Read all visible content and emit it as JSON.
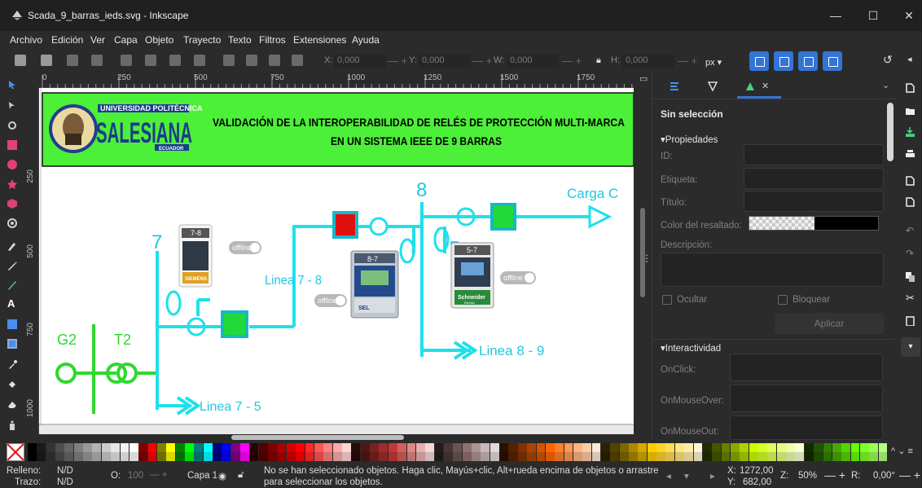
{
  "window": {
    "title": "Scada_9_barras_ieds.svg - Inkscape"
  },
  "menu": [
    "Archivo",
    "Edición",
    "Ver",
    "Capa",
    "Objeto",
    "Trayecto",
    "Texto",
    "Filtros",
    "Extensiones",
    "Ayuda"
  ],
  "toolbar": {
    "x_label": "X:",
    "x_value": "0,000",
    "y_label": "Y:",
    "y_value": "0,000",
    "w_label": "W:",
    "w_value": "0,000",
    "h_label": "H:",
    "h_value": "0,000",
    "unit": "px"
  },
  "ruler": {
    "h_ticks": [
      "0",
      "250",
      "500",
      "750",
      "1000",
      "1250",
      "1500",
      "1750"
    ],
    "v_ticks": [
      "250",
      "500",
      "750",
      "1000"
    ]
  },
  "drawing": {
    "university_top": "UNIVERSIDAD POLITÉCNICA",
    "university_name": "SALESIANA",
    "university_country": "ECUADOR",
    "title_line1": "VALIDACIÓN DE LA INTEROPERABILIDAD DE RELÉS DE PROTECCIÓN MULTI-MARCA",
    "title_line2": "EN UN SISTEMA IEEE DE 9 BARRAS",
    "bus7": "7",
    "bus8": "8",
    "gen": "G2",
    "trafo": "T2",
    "carga": "Carga C",
    "linea78": "Linea 7 - 8",
    "linea89": "Linea 8 - 9",
    "linea75": "Linea 7 - 5",
    "relay1_id": "7-8",
    "relay1_brand": "SIEMENS",
    "relay2_id": "8-7",
    "relay2_brand": "SEL",
    "relay3_id": "5-7",
    "relay3_brand": "Schneider",
    "relay3_sub": "Electric",
    "offline": "offline"
  },
  "panel": {
    "selection": "Sin selección",
    "props_header": "Propiedades",
    "id_label": "ID:",
    "etiqueta_label": "Etiqueta:",
    "titulo_label": "Título:",
    "color_label": "Color del resaltado:",
    "descripcion_label": "Descripción:",
    "ocultar_label": "Ocultar",
    "bloquear_label": "Bloquear",
    "aplicar_label": "Aplicar",
    "interactividad_header": "Interactividad",
    "onclick_label": "OnClick:",
    "onmouseover_label": "OnMouseOver:",
    "onmouseout_label": "OnMouseOut:"
  },
  "palette": [
    "#000000",
    "#1a1a1a",
    "#333333",
    "#4d4d4d",
    "#666666",
    "#808080",
    "#999999",
    "#b3b3b3",
    "#cccccc",
    "#e6e6e6",
    "#f2f2f2",
    "#ffffff",
    "#800000",
    "#ff0000",
    "#808000",
    "#ffff00",
    "#008000",
    "#00ff00",
    "#008080",
    "#00ffff",
    "#000080",
    "#0000ff",
    "#800080",
    "#ff00ff",
    "#2b0000",
    "#550000",
    "#800000",
    "#aa0000",
    "#d40000",
    "#ff0000",
    "#ff2a2a",
    "#ff5555",
    "#ff8080",
    "#ffaaaa",
    "#ffd5d5",
    "#280b0b",
    "#501616",
    "#782121",
    "#a02c2c",
    "#c83737",
    "#d35f5f",
    "#de8787",
    "#e9afaf",
    "#f4d7d7",
    "#241c1c",
    "#483737",
    "#6c5353",
    "#916f6f",
    "#ac9393",
    "#c8b7b7",
    "#e3dbdb",
    "#2b1100",
    "#552200",
    "#803300",
    "#aa4400",
    "#d45500",
    "#ff6600",
    "#ff7f2a",
    "#ff9955",
    "#ffb380",
    "#ffccaa",
    "#ffe6d5",
    "#2b2200",
    "#554400",
    "#806600",
    "#aa8800",
    "#d4aa00",
    "#ffcc00",
    "#ffd42a",
    "#ffdd55",
    "#ffe680",
    "#ffeeaa",
    "#fff6d5",
    "#222b00",
    "#445500",
    "#668000",
    "#88aa00",
    "#aad400",
    "#ccff00",
    "#d4ff2a",
    "#ddff55",
    "#e5ff80",
    "#eeffaa",
    "#f6ffd5",
    "#112b00",
    "#225500",
    "#338000",
    "#44aa00",
    "#55d400",
    "#66ff00",
    "#7fff2a",
    "#99ff55",
    "#b3ff80"
  ],
  "status": {
    "relleno_label": "Relleno:",
    "relleno_value": "N/D",
    "trazo_label": "Trazo:",
    "trazo_value": "N/D",
    "opacity_label": "O:",
    "opacity_value": "100",
    "layer": "Capa 1",
    "message_line1": "No se han seleccionado objetos. Haga clic, Mayús+clic, Alt+rueda encima de objetos o arrastre",
    "message_line2": "para seleccionar los objetos.",
    "x_label": "X:",
    "x_value": "1272,00",
    "y_label": "Y:",
    "y_value": "682,00",
    "zoom_label": "Z:",
    "zoom_value": "50%",
    "rot_label": "R:",
    "rot_value": "0,00°"
  }
}
